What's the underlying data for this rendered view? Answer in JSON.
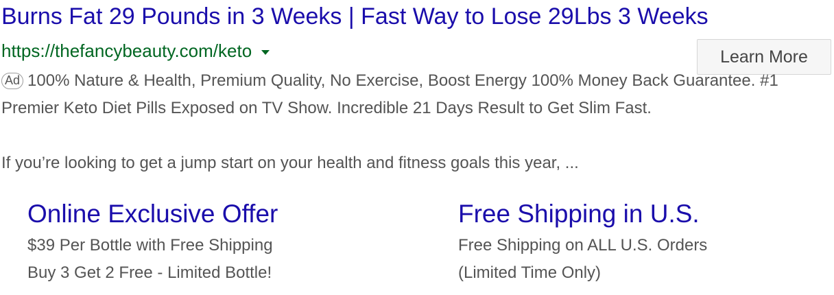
{
  "ad": {
    "title": "Burns Fat 29 Pounds in 3 Weeks | Fast Way to Lose 29Lbs 3 Weeks",
    "url": "https://thefancybeauty.com/keto",
    "badge": "Ad",
    "description": "100% Nature & Health, Premium Quality, No Exercise, Boost Energy 100% Money Back Guarantee. #1 Premier Keto Diet Pills Exposed on TV Show. Incredible 21 Days Result to Get Slim Fast.",
    "snippet": "If you’re looking to get a jump start on your health and fitness goals this year, ...",
    "cta_label": "Learn More"
  },
  "sitelinks": [
    {
      "title": "Online Exclusive Offer",
      "line1": "$39 Per Bottle with Free Shipping",
      "line2": "Buy 3 Get 2 Free - Limited Bottle!"
    },
    {
      "title": "Free Shipping in U.S.",
      "line1": "Free Shipping on ALL U.S. Orders",
      "line2": "(Limited Time Only)"
    }
  ],
  "colors": {
    "link": "#1a0dab",
    "url": "#006621",
    "text": "#545454"
  }
}
